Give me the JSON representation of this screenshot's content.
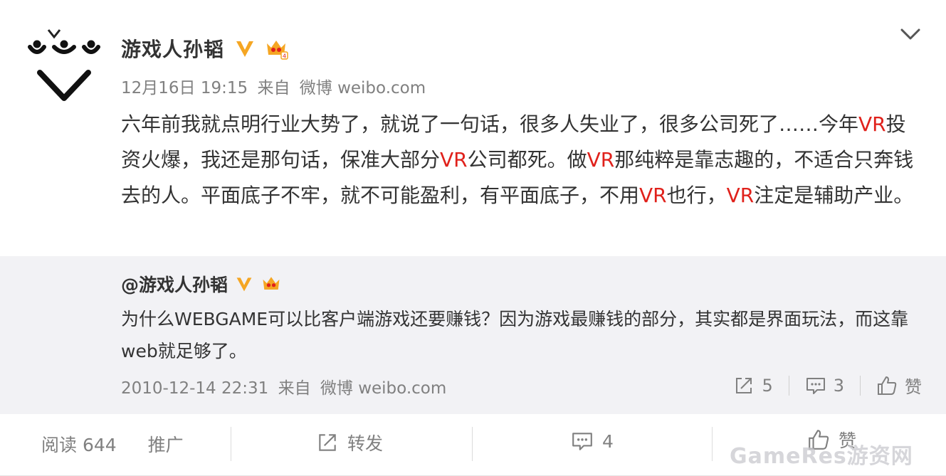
{
  "author": {
    "name": "游戏人孙韬",
    "verified_icon": "verified-v-icon",
    "member_icon": "member-crown-icon"
  },
  "post": {
    "date": "12月16日 19:15",
    "from_label": "来自",
    "source": "微博 weibo.com",
    "text_segments": [
      {
        "t": "六年前我就点明行业大势了，就说了一句话，很多人失业了，很多公司死了……今年",
        "hl": false
      },
      {
        "t": "VR",
        "hl": true
      },
      {
        "t": "投资火爆，我还是那句话，保准大部分",
        "hl": false
      },
      {
        "t": "VR",
        "hl": true
      },
      {
        "t": "公司都死。做",
        "hl": false
      },
      {
        "t": "VR",
        "hl": true
      },
      {
        "t": "那纯粹是靠志趣的，不适合只奔钱去的人。平面底子不牢，就不可能盈利，有平面底子，不用",
        "hl": false
      },
      {
        "t": "VR",
        "hl": true
      },
      {
        "t": "也行，",
        "hl": false
      },
      {
        "t": "VR",
        "hl": true
      },
      {
        "t": "注定是辅助产业。",
        "hl": false
      }
    ]
  },
  "repost": {
    "name": "@游戏人孙韬",
    "text": "为什么WEBGAME可以比客户端游戏还要赚钱？因为游戏最赚钱的部分，其实都是界面玩法，而这靠web就足够了。",
    "date": "2010-12-14 22:31",
    "from_label": "来自",
    "source": "微博 weibo.com",
    "forward_count": "5",
    "comment_count": "3",
    "like_label": "赞"
  },
  "bottom_bar": {
    "read_label": "阅读 644",
    "promote_label": "推广",
    "forward_label": "转发",
    "comment_count": "4",
    "like_label": "赞"
  },
  "watermark": "GameRes游资网",
  "colors": {
    "highlight": "#e0211b",
    "muted": "#808080",
    "repost_bg": "#f2f2f5",
    "verified": "#f5a623"
  }
}
